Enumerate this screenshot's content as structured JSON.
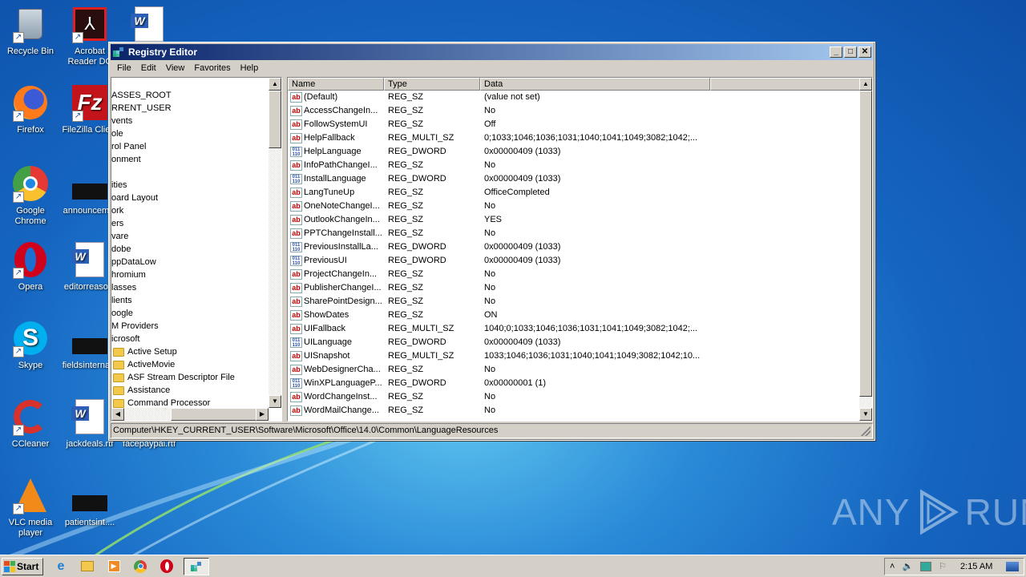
{
  "desktop": {
    "icons": [
      {
        "label": "Recycle Bin",
        "icon": "recycle-bin-icon"
      },
      {
        "label": "Acrobat Reader DC",
        "icon": "acrobat-icon"
      },
      {
        "label": "",
        "icon": "word-document-icon"
      },
      {
        "label": "Firefox",
        "icon": "firefox-icon"
      },
      {
        "label": "FileZilla Client",
        "icon": "filezilla-icon"
      },
      {
        "label": "Google Chrome",
        "icon": "chrome-icon"
      },
      {
        "label": "announcem...",
        "icon": "blank-file-icon"
      },
      {
        "label": "Opera",
        "icon": "opera-icon"
      },
      {
        "label": "editorreaso...",
        "icon": "word-document-icon"
      },
      {
        "label": "Skype",
        "icon": "skype-icon"
      },
      {
        "label": "fieldsinterna...",
        "icon": "blank-file-icon"
      },
      {
        "label": "CCleaner",
        "icon": "ccleaner-icon"
      },
      {
        "label": "jackdeals.rtf",
        "icon": "word-document-icon"
      },
      {
        "label": "facepaypal.rtf",
        "icon": "word-document-icon"
      },
      {
        "label": "VLC media player",
        "icon": "vlc-icon"
      },
      {
        "label": "patientsint....",
        "icon": "blank-file-icon"
      }
    ]
  },
  "window": {
    "title": "Registry Editor",
    "menu": [
      "File",
      "Edit",
      "View",
      "Favorites",
      "Help"
    ],
    "tree": [
      {
        "label": "ASSES_ROOT",
        "folder": false
      },
      {
        "label": "RRENT_USER",
        "folder": false
      },
      {
        "label": "vents",
        "folder": false
      },
      {
        "label": "ole",
        "folder": false
      },
      {
        "label": "rol Panel",
        "folder": false
      },
      {
        "label": "onment",
        "folder": false
      },
      {
        "label": "",
        "folder": false
      },
      {
        "label": "ities",
        "folder": false
      },
      {
        "label": "oard Layout",
        "folder": false
      },
      {
        "label": "ork",
        "folder": false
      },
      {
        "label": "ers",
        "folder": false
      },
      {
        "label": "vare",
        "folder": false
      },
      {
        "label": "dobe",
        "folder": false
      },
      {
        "label": "ppDataLow",
        "folder": false
      },
      {
        "label": "hromium",
        "folder": false
      },
      {
        "label": "lasses",
        "folder": false
      },
      {
        "label": "lients",
        "folder": false
      },
      {
        "label": "oogle",
        "folder": false
      },
      {
        "label": "M Providers",
        "folder": false
      },
      {
        "label": "icrosoft",
        "folder": false
      },
      {
        "label": "Active Setup",
        "folder": true
      },
      {
        "label": "ActiveMovie",
        "folder": true
      },
      {
        "label": "ASF Stream Descriptor File",
        "folder": true
      },
      {
        "label": "Assistance",
        "folder": true
      },
      {
        "label": "Command Processor",
        "folder": true
      }
    ],
    "columns": [
      "Name",
      "Type",
      "Data"
    ],
    "values": [
      {
        "name": "(Default)",
        "type": "REG_SZ",
        "data": "(value not set)"
      },
      {
        "name": "AccessChangeIn...",
        "type": "REG_SZ",
        "data": "No"
      },
      {
        "name": "FollowSystemUI",
        "type": "REG_SZ",
        "data": "Off"
      },
      {
        "name": "HelpFallback",
        "type": "REG_MULTI_SZ",
        "data": "0;1033;1046;1036;1031;1040;1041;1049;3082;1042;..."
      },
      {
        "name": "HelpLanguage",
        "type": "REG_DWORD",
        "data": "0x00000409 (1033)"
      },
      {
        "name": "InfoPathChangeI...",
        "type": "REG_SZ",
        "data": "No"
      },
      {
        "name": "InstallLanguage",
        "type": "REG_DWORD",
        "data": "0x00000409 (1033)"
      },
      {
        "name": "LangTuneUp",
        "type": "REG_SZ",
        "data": "OfficeCompleted"
      },
      {
        "name": "OneNoteChangeI...",
        "type": "REG_SZ",
        "data": "No"
      },
      {
        "name": "OutlookChangeIn...",
        "type": "REG_SZ",
        "data": "YES"
      },
      {
        "name": "PPTChangeInstall...",
        "type": "REG_SZ",
        "data": "No"
      },
      {
        "name": "PreviousInstallLa...",
        "type": "REG_DWORD",
        "data": "0x00000409 (1033)"
      },
      {
        "name": "PreviousUI",
        "type": "REG_DWORD",
        "data": "0x00000409 (1033)"
      },
      {
        "name": "ProjectChangeIn...",
        "type": "REG_SZ",
        "data": "No"
      },
      {
        "name": "PublisherChangeI...",
        "type": "REG_SZ",
        "data": "No"
      },
      {
        "name": "SharePointDesign...",
        "type": "REG_SZ",
        "data": "No"
      },
      {
        "name": "ShowDates",
        "type": "REG_SZ",
        "data": "ON"
      },
      {
        "name": "UIFallback",
        "type": "REG_MULTI_SZ",
        "data": "1040;0;1033;1046;1036;1031;1041;1049;3082;1042;..."
      },
      {
        "name": "UILanguage",
        "type": "REG_DWORD",
        "data": "0x00000409 (1033)"
      },
      {
        "name": "UISnapshot",
        "type": "REG_MULTI_SZ",
        "data": "1033;1046;1036;1031;1040;1041;1049;3082;1042;10..."
      },
      {
        "name": "WebDesignerCha...",
        "type": "REG_SZ",
        "data": "No"
      },
      {
        "name": "WinXPLanguageP...",
        "type": "REG_DWORD",
        "data": "0x00000001 (1)"
      },
      {
        "name": "WordChangeInst...",
        "type": "REG_SZ",
        "data": "No"
      },
      {
        "name": "WordMailChange...",
        "type": "REG_SZ",
        "data": "No"
      }
    ],
    "status_path": "Computer\\HKEY_CURRENT_USER\\Software\\Microsoft\\Office\\14.0\\Common\\LanguageResources"
  },
  "taskbar": {
    "start_label": "Start",
    "pinned": [
      "internet-explorer-icon",
      "file-explorer-icon",
      "media-player-icon",
      "chrome-icon",
      "opera-icon"
    ],
    "active": "registry-editor-icon",
    "clock": "2:15 AM"
  },
  "watermark": {
    "left": "ANY",
    "right": "RUN"
  }
}
